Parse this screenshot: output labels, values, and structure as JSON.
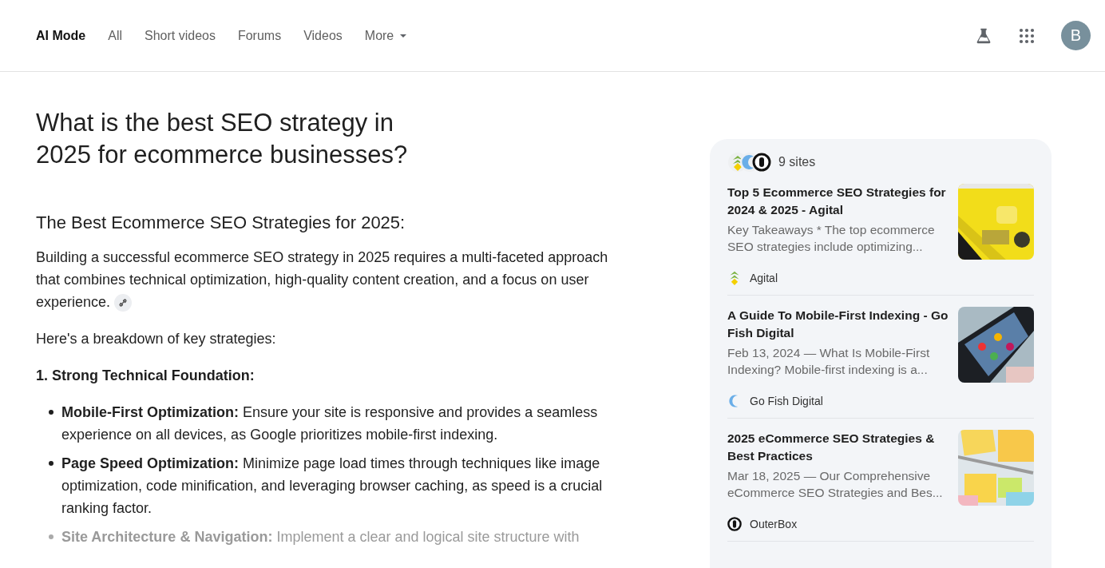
{
  "tabs": [
    {
      "label": "AI Mode",
      "selected": true
    },
    {
      "label": "All",
      "selected": false
    },
    {
      "label": "Short videos",
      "selected": false
    },
    {
      "label": "Forums",
      "selected": false
    },
    {
      "label": "Videos",
      "selected": false
    },
    {
      "label": "More",
      "selected": false,
      "dropdown": true
    }
  ],
  "avatar": {
    "initial": "B"
  },
  "question": "What is the best SEO strategy in 2025 for ecommerce businesses?",
  "answer": {
    "heading": "The Best Ecommerce SEO Strategies for 2025:",
    "intro": "Building a successful ecommerce SEO strategy in 2025 requires a multi-faceted approach that combines technical optimization, high-quality content creation, and a focus on user experience.",
    "lead": "Here's a breakdown of key strategies:",
    "section": "1. Strong Technical Foundation:",
    "bullets": [
      {
        "text": "**Mobile-First Optimization:** Ensure your site is responsive and provides a seamless experience on all devices, as Google prioritizes mobile-first indexing.",
        "faded": false
      },
      {
        "text": "**Page Speed Optimization:** Minimize page load times through techniques like image optimization, code minification, and leveraging browser caching, as speed is a crucial ranking factor.",
        "faded": false
      },
      {
        "text": "**Site Architecture & Navigation:** Implement a clear and logical site structure with",
        "faded": true
      }
    ]
  },
  "sources": {
    "count": "9 sites",
    "items": [
      {
        "title": "Top 5 Ecommerce SEO Strategies for 2024 & 2025 - Agital",
        "snippet": "Key Takeaways * The top ecommerce SEO strategies include optimizing...",
        "site": "Agital"
      },
      {
        "title": "A Guide To Mobile-First Indexing - Go Fish Digital",
        "snippet": "Feb 13, 2024 — What Is Mobile-First Indexing? Mobile-first indexing is a...",
        "site": "Go Fish Digital"
      },
      {
        "title": "2025 eCommerce SEO Strategies & Best Practices",
        "snippet": "Mar 18, 2025 — Our Comprehensive eCommerce SEO Strategies and Bes...",
        "site": "OuterBox"
      }
    ]
  }
}
